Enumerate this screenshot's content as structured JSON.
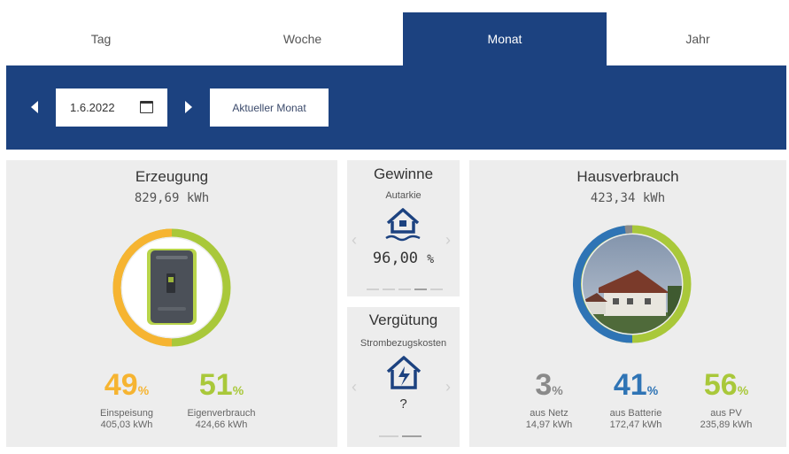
{
  "tabs": [
    {
      "label": "Tag",
      "active": false
    },
    {
      "label": "Woche",
      "active": false
    },
    {
      "label": "Monat",
      "active": true
    },
    {
      "label": "Jahr",
      "active": false
    }
  ],
  "toolbar": {
    "date_value": "1.6.2022",
    "current_month_label": "Aktueller Monat"
  },
  "erzeugung": {
    "title": "Erzeugung",
    "total": "829,69 kWh",
    "einspeisung": {
      "pct": "49",
      "unit": "%",
      "label": "Einspeisung",
      "value": "405,03 kWh",
      "color": "#f6b431"
    },
    "eigenverbrauch": {
      "pct": "51",
      "unit": "%",
      "label": "Eigenverbrauch",
      "value": "424,66 kWh",
      "color": "#a9c83a"
    }
  },
  "gewinne": {
    "title": "Gewinne",
    "subtitle": "Autarkie",
    "value": "96,00",
    "unit": "%"
  },
  "verguetung": {
    "title": "Vergütung",
    "subtitle": "Strombezugskosten",
    "value": "?"
  },
  "hausverbrauch": {
    "title": "Hausverbrauch",
    "total": "423,34 kWh",
    "netz": {
      "pct": "3",
      "unit": "%",
      "label": "aus Netz",
      "value": "14,97 kWh",
      "color": "#8a8a8a"
    },
    "batterie": {
      "pct": "41",
      "unit": "%",
      "label": "aus Batterie",
      "value": "172,47 kWh",
      "color": "#2f74b5"
    },
    "pv": {
      "pct": "56",
      "unit": "%",
      "label": "aus PV",
      "value": "235,89 kWh",
      "color": "#a9c83a"
    }
  },
  "colors": {
    "brand": "#1c4280",
    "panel": "#ededed"
  }
}
